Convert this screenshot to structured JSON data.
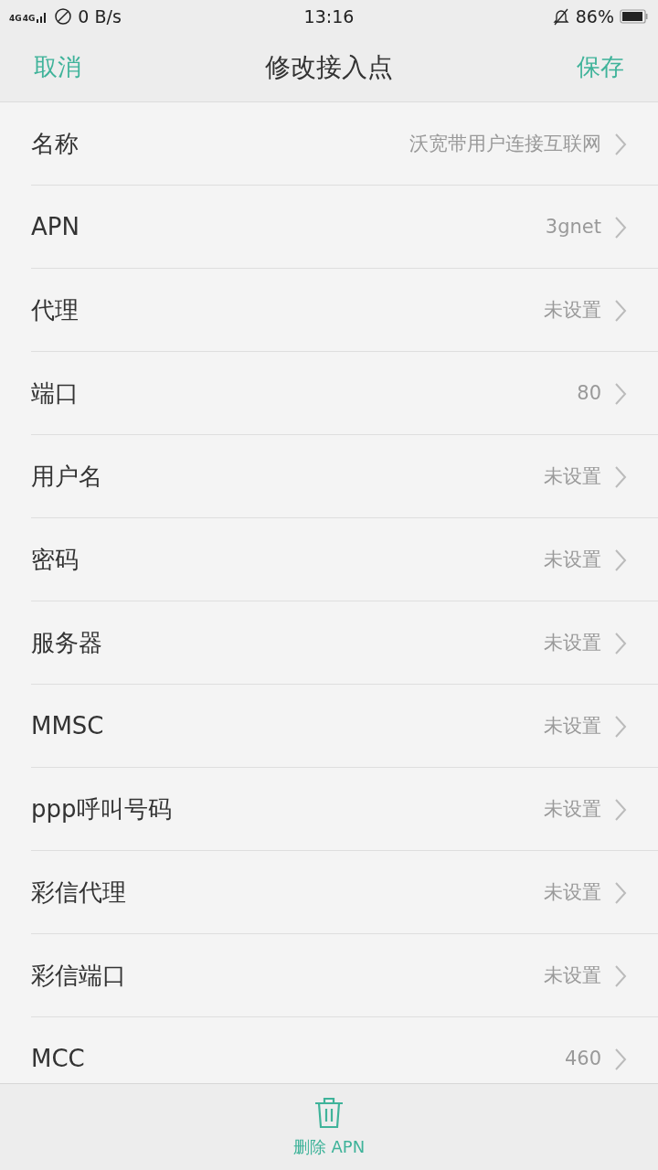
{
  "status_bar": {
    "networks": [
      "4G",
      "4G"
    ],
    "speed": "0 B/s",
    "time": "13:16",
    "battery": "86%"
  },
  "header": {
    "cancel": "取消",
    "title": "修改接入点",
    "save": "保存"
  },
  "rows": [
    {
      "label": "名称",
      "value": "沃宽带用户连接互联网"
    },
    {
      "label": "APN",
      "value": "3gnet"
    },
    {
      "label": "代理",
      "value": "未设置"
    },
    {
      "label": "端口",
      "value": "80"
    },
    {
      "label": "用户名",
      "value": "未设置"
    },
    {
      "label": "密码",
      "value": "未设置"
    },
    {
      "label": "服务器",
      "value": "未设置"
    },
    {
      "label": "MMSC",
      "value": "未设置"
    },
    {
      "label": "ppp呼叫号码",
      "value": "未设置"
    },
    {
      "label": "彩信代理",
      "value": "未设置"
    },
    {
      "label": "彩信端口",
      "value": "未设置"
    },
    {
      "label": "MCC",
      "value": "460"
    }
  ],
  "footer": {
    "delete": "删除 APN"
  }
}
